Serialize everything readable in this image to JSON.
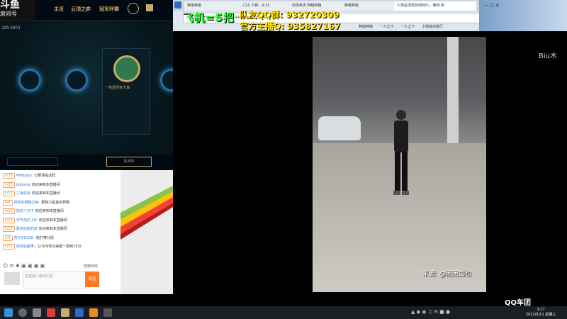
{
  "lol_client": {
    "nav": [
      "主页",
      "云顶之弈",
      "冠军杯赛"
    ],
    "champion_label": "一塔蓝回家大海",
    "find_match": "队列中"
  },
  "douyu": {
    "logo": "斗鱼",
    "subtitle": "房间号",
    "room_number": "2853803"
  },
  "chat": {
    "messages": [
      {
        "level": "lv10",
        "name": "呵Wbaby:",
        "text": "记那谁是这样"
      },
      {
        "level": "lv15",
        "name": "bdjdsng",
        "text": "欢迎来到本直播间"
      },
      {
        "level": "lv12",
        "name": "三色豹哥",
        "text": "欢迎来到本直播间"
      },
      {
        "level": "lv8",
        "name": "风吹的啊路过等:",
        "text": "那我力是真的舒服"
      },
      {
        "level": "lv16",
        "name": "指天八只爪",
        "text": "欢迎来到本直播间"
      },
      {
        "level": "lv10",
        "name": "洋气泡仔小伙",
        "text": "欢迎来到本直播间"
      },
      {
        "level": "lv13",
        "name": "最佳直能的双",
        "text": "欢迎来到本直播间"
      },
      {
        "level": "lv9",
        "name": "男子2102年:",
        "text": "能打等分段"
      },
      {
        "level": "lv11",
        "name": "保高后面带-:",
        "text": "让弓为你白得需一把到15分"
      }
    ],
    "input_placeholder": "这里输入聊天内容",
    "send_label": "发送",
    "filter_label": "屏蔽特效"
  },
  "browser": {
    "tabs": [
      "种植种植",
      "...门小 下钟 - 9:25",
      "动态新页 种植种植",
      "种植种植",
      "人类是怎样找到的Fu...莱特 和"
    ],
    "url": "95w1y1/1f596nn_to_from=44d41bscardi and",
    "bookmarks": [
      "种植种植",
      "一人之下",
      "一人之下",
      "小强首宗复行"
    ]
  },
  "overlay": {
    "plane": "飞机=5把",
    "qq": "队友QQ群: 932720309",
    "group": "官方主播Q: 935827167"
  },
  "video": {
    "source": "来源: @困困如也",
    "side_name": "Biu木"
  },
  "taskbar": {
    "time": "3:17",
    "date": "2022/5/11 星期三",
    "brand": "QQ车团"
  },
  "colors": {
    "overlay_green": "#22ff33",
    "overlay_yellow": "#ffde00",
    "send_orange": "#ff7a1e",
    "lol_gold": "#c8aa6e"
  }
}
